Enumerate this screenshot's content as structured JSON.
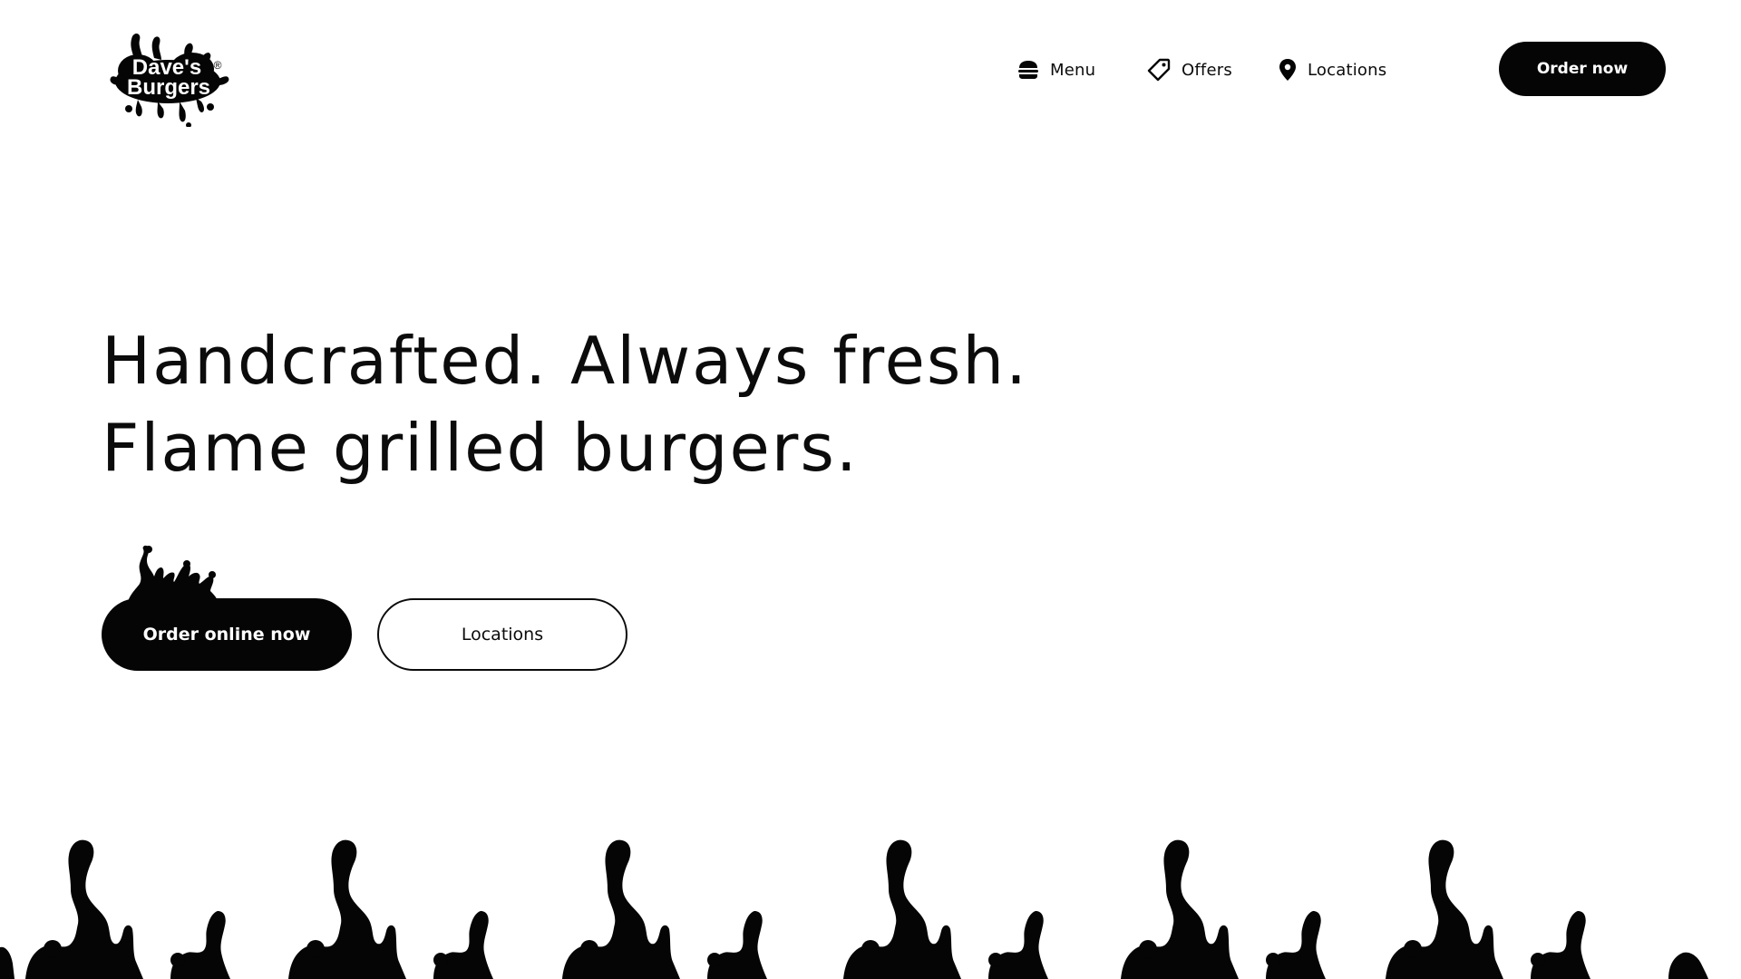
{
  "header": {
    "logo": {
      "line1": "Dave's",
      "line2": "Burgers",
      "mark": "®"
    },
    "nav": [
      {
        "label": "Menu",
        "icon": "burger-icon"
      },
      {
        "label": "Offers",
        "icon": "tag-icon"
      },
      {
        "label": "Locations",
        "icon": "map-pin-icon"
      }
    ],
    "order_button": "Order now"
  },
  "hero": {
    "headline_line1": "Handcrafted. Always fresh.",
    "headline_line2": "Flame grilled burgers.",
    "primary_cta": "Order online now",
    "secondary_cta": "Locations"
  },
  "colors": {
    "primary": "#050505",
    "background": "#ffffff",
    "text": "#0b0b0b"
  }
}
